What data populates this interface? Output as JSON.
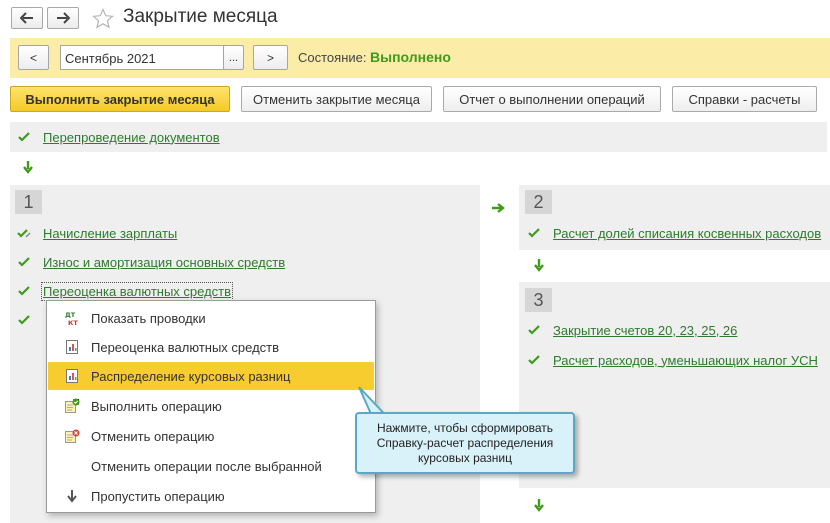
{
  "window": {
    "title": "Закрытие месяца"
  },
  "period_bar": {
    "prev_label": "<",
    "period_value": "Сентябрь 2021",
    "select_label": "...",
    "next_label": ">",
    "state_label": "Состояние:",
    "state_value": "Выполнено"
  },
  "toolbar": {
    "run_close": "Выполнить закрытие месяца",
    "cancel_close": "Отменить закрытие месяца",
    "report": "Отчет о выполнении операций",
    "references": "Справки - расчеты"
  },
  "ops": {
    "reposting": "Перепроведение документов",
    "step1_num": "1",
    "salary": "Начисление зарплаты",
    "depreciation": "Износ и амортизация основных средств",
    "revaluation": "Переоценка валютных средств",
    "step2_num": "2",
    "indirect_shares": "Расчет долей списания косвенных расходов",
    "step3_num": "3",
    "close_accounts": "Закрытие счетов 20, 23, 25, 26",
    "usn_expenses": "Расчет расходов, уменьшающих налог УСН"
  },
  "menu": {
    "items": [
      {
        "label": "Показать проводки",
        "icon": "dt-kt-icon"
      },
      {
        "label": "Переоценка валютных средств",
        "icon": "report-icon"
      },
      {
        "label": "Распределение курсовых разниц",
        "icon": "report-icon"
      },
      {
        "label": "Выполнить операцию",
        "icon": "run-operation-icon"
      },
      {
        "label": "Отменить операцию",
        "icon": "cancel-operation-icon"
      },
      {
        "label": "Отменить операции после выбранной",
        "icon": ""
      },
      {
        "label": "Пропустить операцию",
        "icon": "arrow-down-icon"
      }
    ],
    "icon_text": "ДТ\nКТ"
  },
  "tooltip": {
    "line1": "Нажмите, чтобы сформировать",
    "line2": "Справку-расчет распределения",
    "line3": "курсовых разниц"
  },
  "colors": {
    "accent": "#f7cc2e",
    "link": "#2f7a2f",
    "success": "#3f9a1e",
    "state_bar": "#fbeca7"
  }
}
